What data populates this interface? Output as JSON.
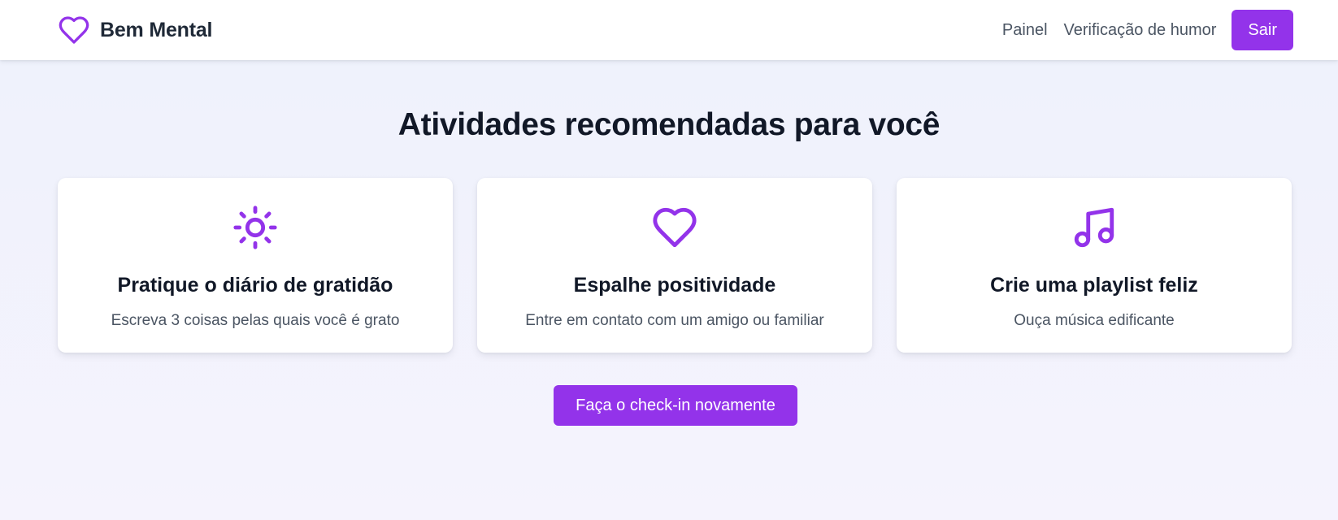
{
  "colors": {
    "accent": "#9333ea",
    "background": "#eef2fc",
    "text": "#111827",
    "muted": "#4b5563"
  },
  "nav": {
    "brand": {
      "icon": "heart-icon",
      "name": "Bem Mental"
    },
    "links": [
      "Painel",
      "Verificação de humor"
    ],
    "logout_label": "Sair"
  },
  "main": {
    "title": "Atividades recomendadas para você",
    "cards": [
      {
        "icon": "sun-icon",
        "title": "Pratique o diário de gratidão",
        "description": "Escreva 3 coisas pelas quais você é grato"
      },
      {
        "icon": "heart-icon",
        "title": "Espalhe positividade",
        "description": "Entre em contato com um amigo ou familiar"
      },
      {
        "icon": "music-icon",
        "title": "Crie uma playlist feliz",
        "description": "Ouça música edificante"
      }
    ],
    "checkin_label": "Faça o check-in novamente"
  }
}
